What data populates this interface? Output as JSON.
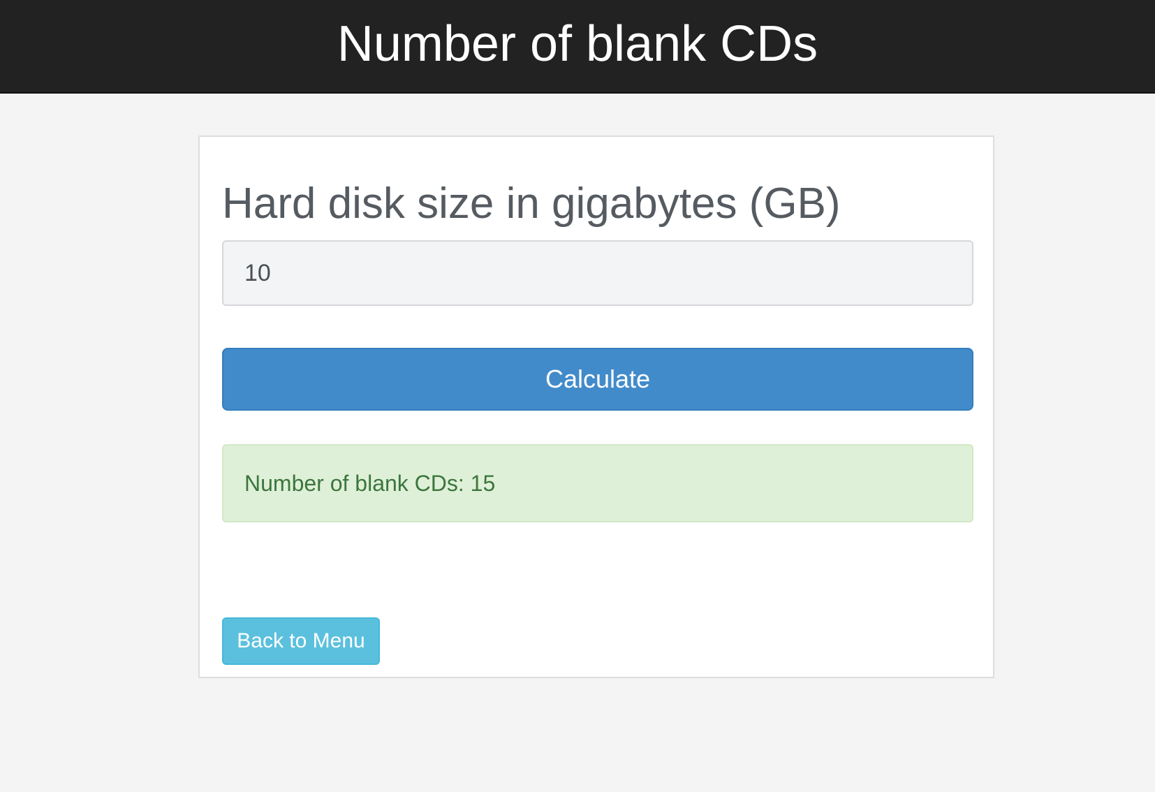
{
  "header": {
    "title": "Number of blank CDs"
  },
  "form": {
    "label": "Hard disk size in gigabytes (GB)",
    "input_value": "10",
    "calculate_label": "Calculate"
  },
  "result": {
    "text": "Number of blank CDs: 15"
  },
  "nav": {
    "back_label": "Back to Menu"
  },
  "colors": {
    "header_bg": "#222222",
    "primary_button": "#428bca",
    "success_bg": "#dff0d8",
    "success_text": "#3c763d",
    "info_button": "#5bc0de"
  }
}
